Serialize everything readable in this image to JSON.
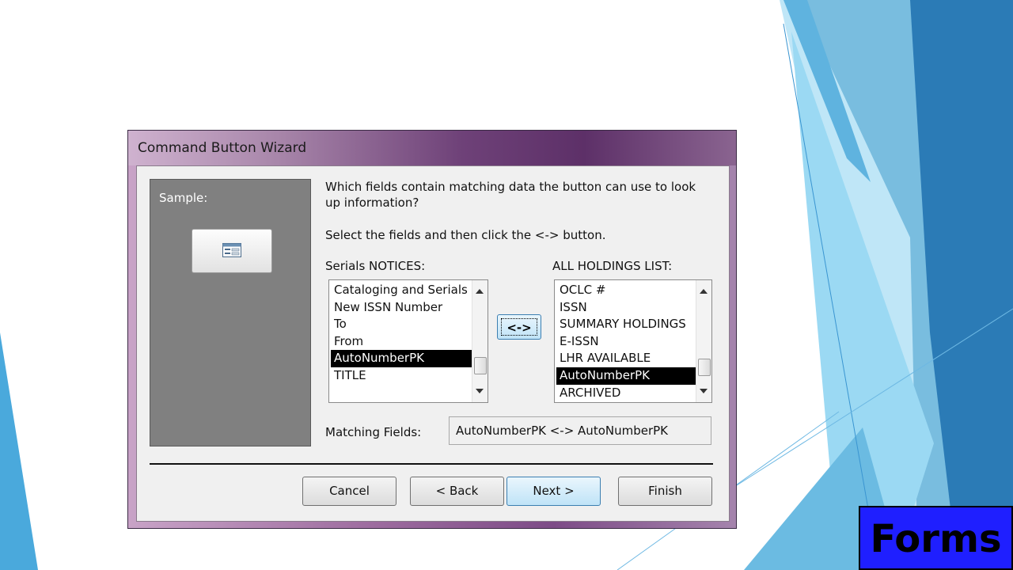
{
  "dialog": {
    "title": "Command Button Wizard",
    "sample_label": "Sample:",
    "question": "Which fields contain matching data the button can use to look up information?",
    "instruction": "Select the fields and then click the <-> button.",
    "left_list": {
      "label": "Serials NOTICES:",
      "items": [
        "Cataloging and Serials",
        "New ISSN Number",
        "To",
        "From",
        "AutoNumberPK",
        "TITLE"
      ],
      "selected": "AutoNumberPK"
    },
    "right_list": {
      "label": "ALL HOLDINGS LIST:",
      "items": [
        "OCLC #",
        "ISSN",
        "SUMMARY HOLDINGS",
        "E-ISSN",
        "LHR AVAILABLE",
        "AutoNumberPK",
        "ARCHIVED"
      ],
      "selected": "AutoNumberPK"
    },
    "swap_button": "<->",
    "matching_label": "Matching Fields:",
    "matching_value": "AutoNumberPK <-> AutoNumberPK",
    "buttons": {
      "cancel": "Cancel",
      "back": "< Back",
      "next": "Next >",
      "finish": "Finish"
    }
  },
  "slide": {
    "label": "Forms"
  },
  "colors": {
    "title_gradient_dark": "#5d3068",
    "selection_bg": "#000000",
    "forms_bg": "#1f1fff",
    "slide_blue_dark": "#1a73b5",
    "slide_blue_light": "#8fd3f0"
  },
  "icons": {
    "sample_button_icon": "form-icon"
  }
}
